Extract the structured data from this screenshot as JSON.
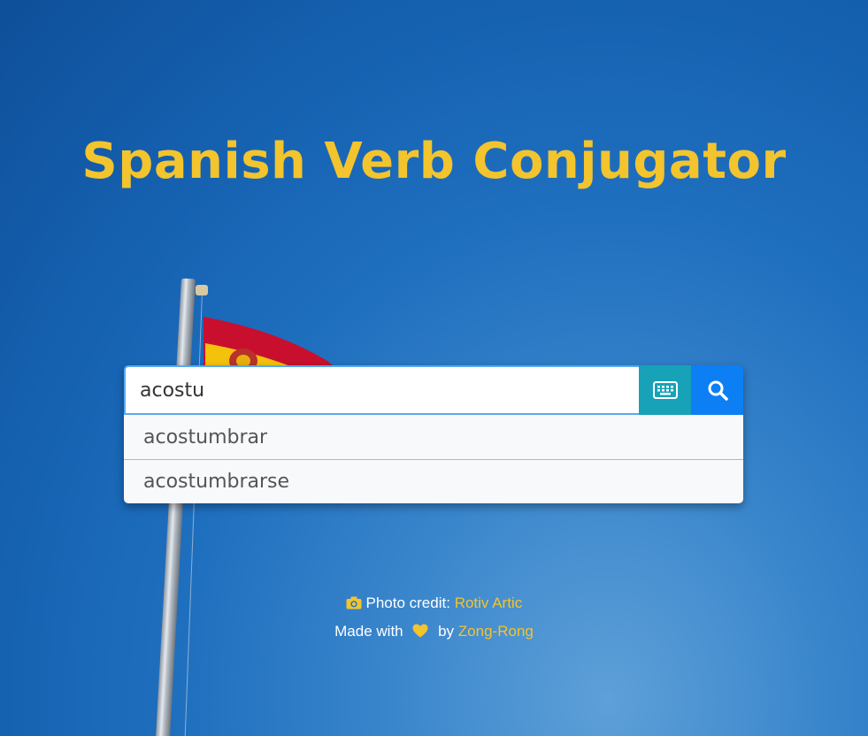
{
  "header": {
    "title": "Spanish Verb Conjugator"
  },
  "search": {
    "value": "acostu",
    "suggestions": [
      "acostumbrar",
      "acostumbrarse"
    ],
    "keyboard_icon": "keyboard-icon",
    "search_icon": "search-icon"
  },
  "footer": {
    "photo_label": "Photo credit:",
    "photo_author": "Rotiv Artic",
    "made_with": "Made with",
    "by": "by",
    "author": "Zong-Rong",
    "camera_icon": "camera-icon",
    "heart_icon": "heart-icon"
  },
  "colors": {
    "accent": "#f3c42d",
    "keyboard_button": "#17a2b8",
    "search_button": "#0d7ff5",
    "background": "#1f6fbf"
  }
}
